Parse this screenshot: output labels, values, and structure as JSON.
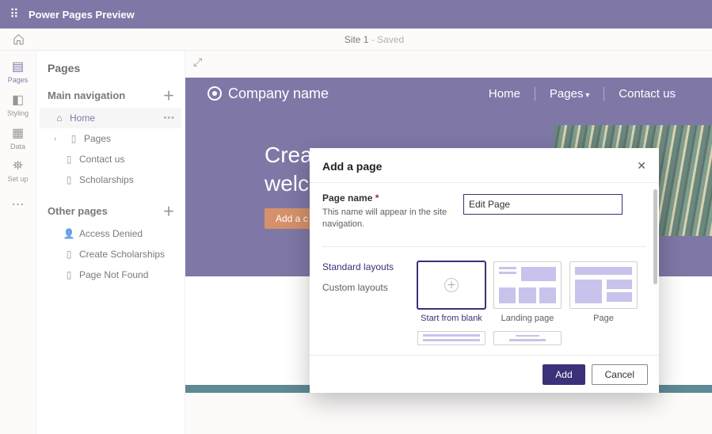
{
  "app_title": "Power Pages Preview",
  "site": {
    "name": "Site 1",
    "status": "Saved"
  },
  "rail": [
    {
      "id": "pages",
      "label": "Pages",
      "active": true
    },
    {
      "id": "styling",
      "label": "Styling"
    },
    {
      "id": "data",
      "label": "Data"
    },
    {
      "id": "setup",
      "label": "Set up"
    }
  ],
  "pages_panel": {
    "title": "Pages",
    "sections": {
      "main_nav": {
        "title": "Main navigation",
        "items": [
          {
            "label": "Home",
            "selected": true
          },
          {
            "label": "Pages",
            "hasChildren": true
          },
          {
            "label": "Contact us"
          },
          {
            "label": "Scholarships"
          }
        ]
      },
      "other": {
        "title": "Other pages",
        "items": [
          {
            "label": "Access Denied"
          },
          {
            "label": "Create Scholarships"
          },
          {
            "label": "Page Not Found"
          }
        ]
      }
    }
  },
  "preview": {
    "brand": "Company name",
    "nav": [
      "Home",
      "Pages",
      "Contact us"
    ],
    "hero_line1": "Crea",
    "hero_line2": "welc",
    "hero_button": "Add a c"
  },
  "dialog": {
    "title": "Add a page",
    "field_label": "Page name",
    "field_help": "This name will appear in the site navigation.",
    "field_value": "Edit Page",
    "layout_tabs": {
      "standard": "Standard layouts",
      "custom": "Custom layouts"
    },
    "layouts": [
      {
        "label": "Start from blank",
        "selected": true
      },
      {
        "label": "Landing page"
      },
      {
        "label": "Page"
      }
    ],
    "buttons": {
      "add": "Add",
      "cancel": "Cancel"
    }
  }
}
